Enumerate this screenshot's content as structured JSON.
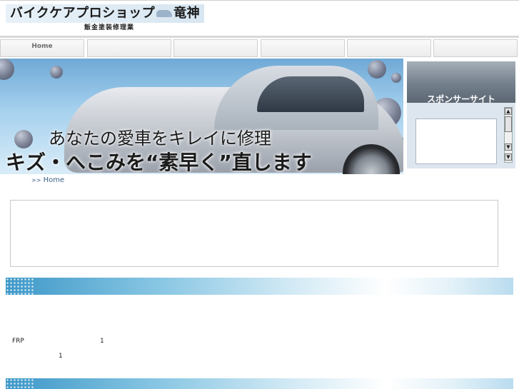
{
  "header": {
    "logo_title_part1": "バイクケアプロショップ",
    "logo_title_part2": "竜神",
    "logo_subtitle": "飯金塗装修理業"
  },
  "nav": {
    "tabs": [
      {
        "label": "Home"
      },
      {
        "label": ""
      },
      {
        "label": ""
      },
      {
        "label": ""
      },
      {
        "label": ""
      },
      {
        "label": ""
      }
    ]
  },
  "hero": {
    "line1": "あなたの愛車をキレイに修理",
    "line2": "キズ・へこみを“素早く”直します"
  },
  "sponsor": {
    "title": "スポンサーサイト",
    "scroll_up_icon": "▲",
    "scroll_down_icon": "▼"
  },
  "breadcrumb": {
    "separator": ">>",
    "home_label": "Home"
  },
  "content": {
    "frp_label": "FRP",
    "count_a": "1",
    "count_b": "1"
  },
  "colors": {
    "accent_blue": "#3d98c8",
    "link": "#3a5f86"
  }
}
